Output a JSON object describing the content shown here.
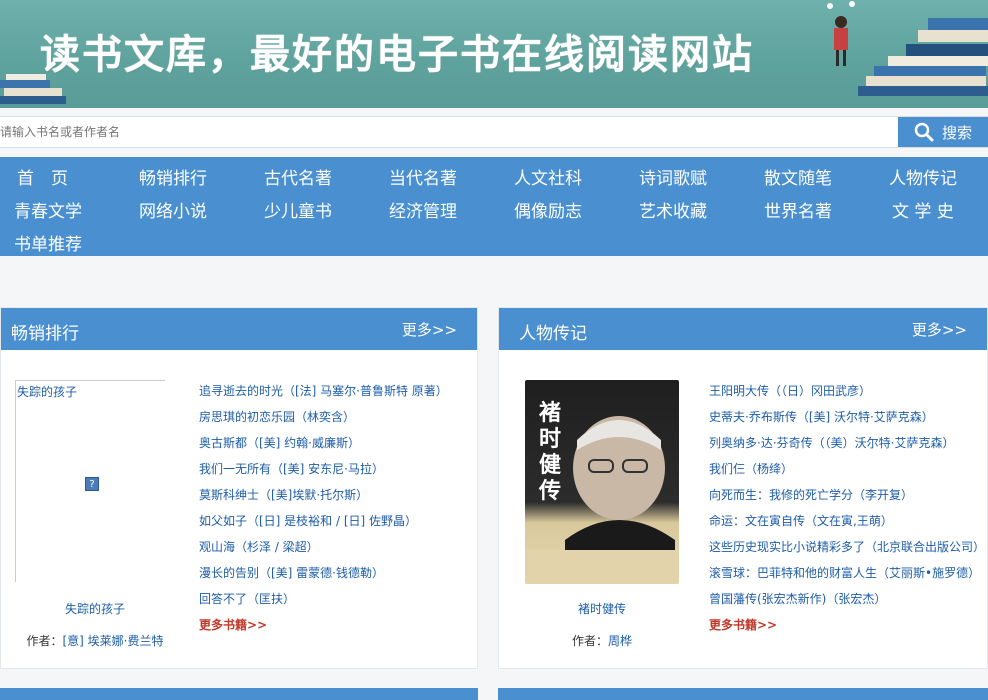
{
  "banner": {
    "prefix": "读",
    "title": "书文库，最好的电子书在线阅读网站"
  },
  "search": {
    "placeholder": "请输入书名或者作者名",
    "button_label": "搜索"
  },
  "nav": [
    "首　页",
    "畅销排行",
    "古代名著",
    "当代名著",
    "人文社科",
    "诗词歌赋",
    "散文随笔",
    "人物传记",
    "青春文学",
    "网络小说",
    "少儿童书",
    "经济管理",
    "偶像励志",
    "艺术收藏",
    "世界名著",
    "文 学 史",
    "书单推荐"
  ],
  "panels": [
    {
      "title": "畅销排行",
      "more": "更多>>",
      "cover_alt": "失踪的孩子",
      "cover_caption": "失踪的孩子",
      "author_label": "作者：",
      "author": "[意] 埃莱娜·费兰特",
      "items": [
        "追寻逝去的时光（[法] 马塞尔·普鲁斯特 原著）",
        "房思琪的初恋乐园（林奕含）",
        "奥古斯都（[美] 约翰·威廉斯）",
        "我们一无所有（[美] 安东尼·马拉）",
        "莫斯科绅士（[美]埃默·托尔斯）",
        "如父如子（[日] 是枝裕和 / [日] 佐野晶）",
        "观山海（杉泽 / 梁超）",
        "漫长的告别（[美] 雷蒙德·钱德勒）",
        "回答不了（匡扶）"
      ],
      "more_books": "更多书籍>>"
    },
    {
      "title": "人物传记",
      "more": "更多>>",
      "cover_title": "褚时健传",
      "cover_caption": "褚时健传",
      "author_label": "作者：",
      "author": "周桦",
      "items": [
        "王阳明大传（（日）冈田武彦）",
        "史蒂夫·乔布斯传（[美] 沃尔特·艾萨克森）",
        "列奥纳多·达·芬奇传（（美）沃尔特·艾萨克森）",
        "我们仨（杨绛）",
        "向死而生：我修的死亡学分（李开复）",
        "命运：文在寅自传（文在寅,王萌）",
        "这些历史现实比小说精彩多了（北京联合出版公司）",
        "滚雪球：巴菲特和他的财富人生（艾丽斯•施罗德）",
        "曾国藩传(张宏杰新作)（张宏杰）"
      ],
      "more_books": "更多书籍>>"
    }
  ],
  "colors": {
    "accent": "#4a90d0",
    "link": "#1e5da8",
    "more_books": "#c0392b",
    "banner": "#5fa39e"
  },
  "icons": {
    "search": "search-icon",
    "broken_image": "broken-image-icon"
  }
}
